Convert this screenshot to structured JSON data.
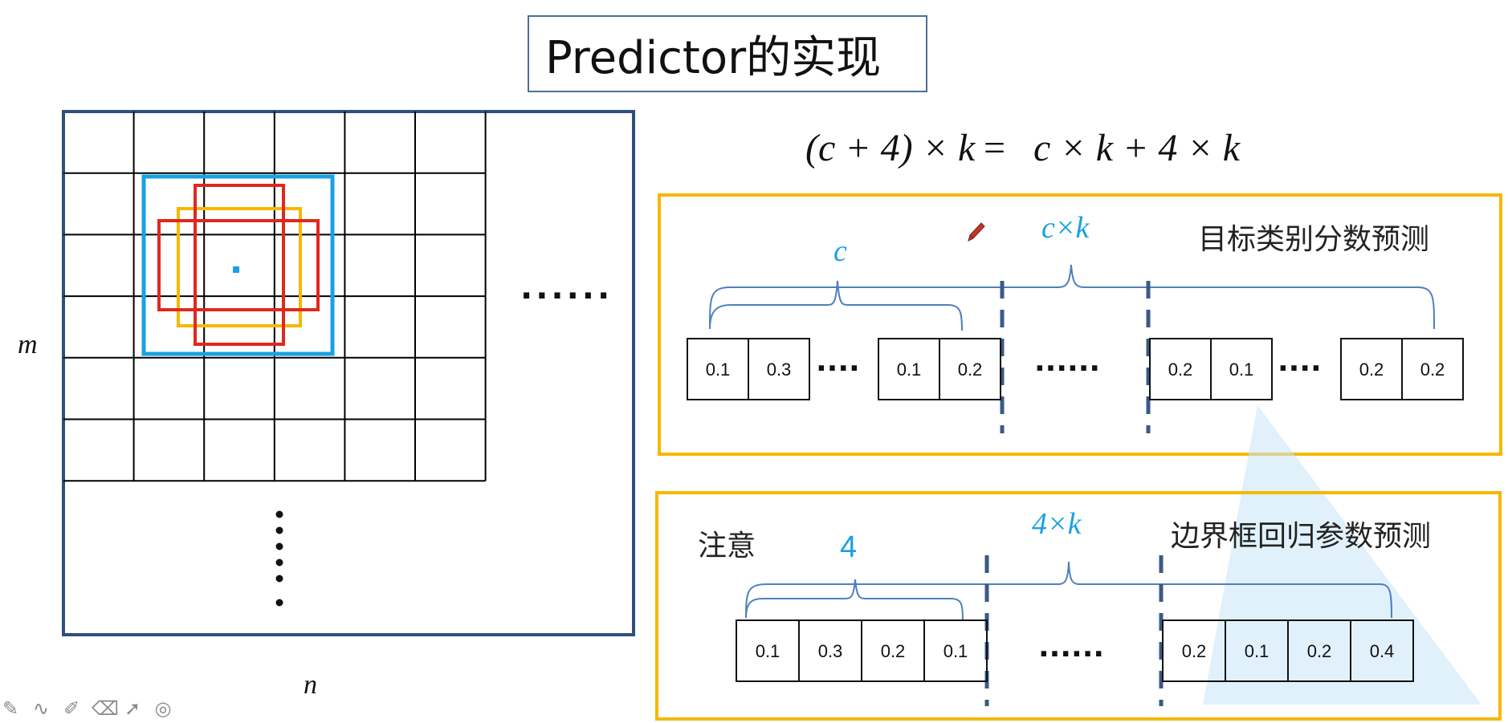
{
  "slide": {
    "title": "Predictor的实现",
    "formula": {
      "lhs": "(c + 4) × k",
      "eq": "=",
      "rhs": "c × k + 4 × k"
    }
  },
  "grid": {
    "rows": 6,
    "cols": 6,
    "row_label": "m",
    "col_label": "n",
    "h_ellipsis": "......",
    "v_ellipsis": ":"
  },
  "class_panel": {
    "heading": "目标类别分数预测",
    "brace_inner_label": "c",
    "brace_outer_label": "c×k",
    "cells_left": [
      "0.1",
      "0.3"
    ],
    "dots_a": "....",
    "cells_mid": [
      "0.1",
      "0.2"
    ],
    "dots_b": "......",
    "cells_right_a": [
      "0.2",
      "0.1"
    ],
    "dots_c": "....",
    "cells_right_b": [
      "0.2",
      "0.2"
    ]
  },
  "box_panel": {
    "heading": "边界框回归参数预测",
    "note": "注意",
    "brace_inner_label": "4",
    "brace_outer_label": "4×k",
    "cells_left": [
      "0.1",
      "0.3",
      "0.2",
      "0.1"
    ],
    "dots": "......",
    "cells_right": [
      "0.2",
      "0.1",
      "0.2",
      "0.4"
    ]
  },
  "colors": {
    "grid_line": "#000000",
    "frame": "#2f4f7f",
    "blue_box": "#1ba1e2",
    "yellow_box": "#f5b800",
    "red_box": "#e0281e",
    "panel_border": "#f5b800",
    "brace": "#4f7fbf",
    "dashed": "#3a5a86",
    "accent_text": "#1ba1e2"
  },
  "toolbar": {
    "icons": [
      "brush-icon",
      "curve-icon",
      "highlighter-icon",
      "eraser-icon",
      "pointer-icon",
      "target-icon"
    ]
  }
}
